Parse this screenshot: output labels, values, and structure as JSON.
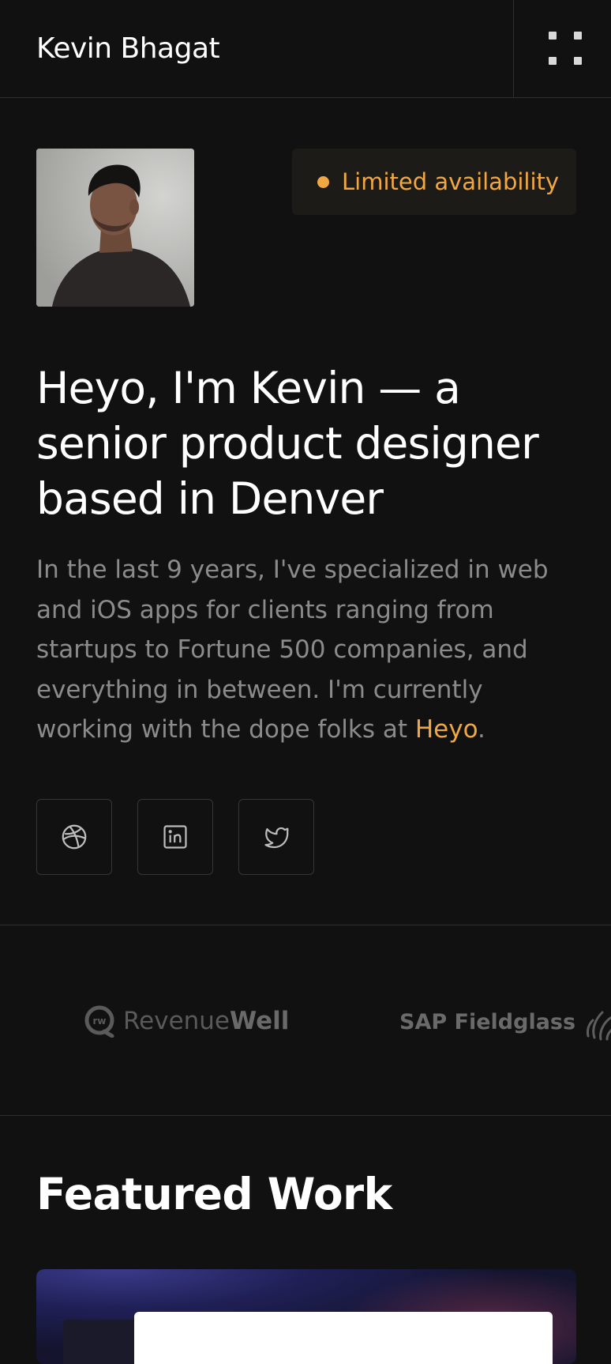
{
  "header": {
    "brand": "Kevin Bhagat",
    "menu_icon": "grid-menu-icon"
  },
  "hero": {
    "avatar_alt": "portrait-photo",
    "availability": "Limited availability",
    "availability_color": "#f2a842",
    "headline": "Heyo, I'm Kevin — a senior product designer based in Denver",
    "intro_text": "In the last 9 years, I've specialized in web and iOS apps for clients ranging from startups to Fortune 500 companies, and everything in between. I'm currently working with the dope folks at ",
    "intro_link": "Heyo",
    "intro_end": "."
  },
  "social": [
    {
      "name": "dribbble-icon"
    },
    {
      "name": "linkedin-icon"
    },
    {
      "name": "twitter-icon"
    }
  ],
  "clients": {
    "revenuewell_light": "Revenue",
    "revenuewell_bold": "Well",
    "sap": "SAP Fieldglass"
  },
  "featured": {
    "title": "Featured Work"
  },
  "colors": {
    "background": "#111111",
    "accent": "#f2a842",
    "muted_text": "#8b8b8b"
  }
}
